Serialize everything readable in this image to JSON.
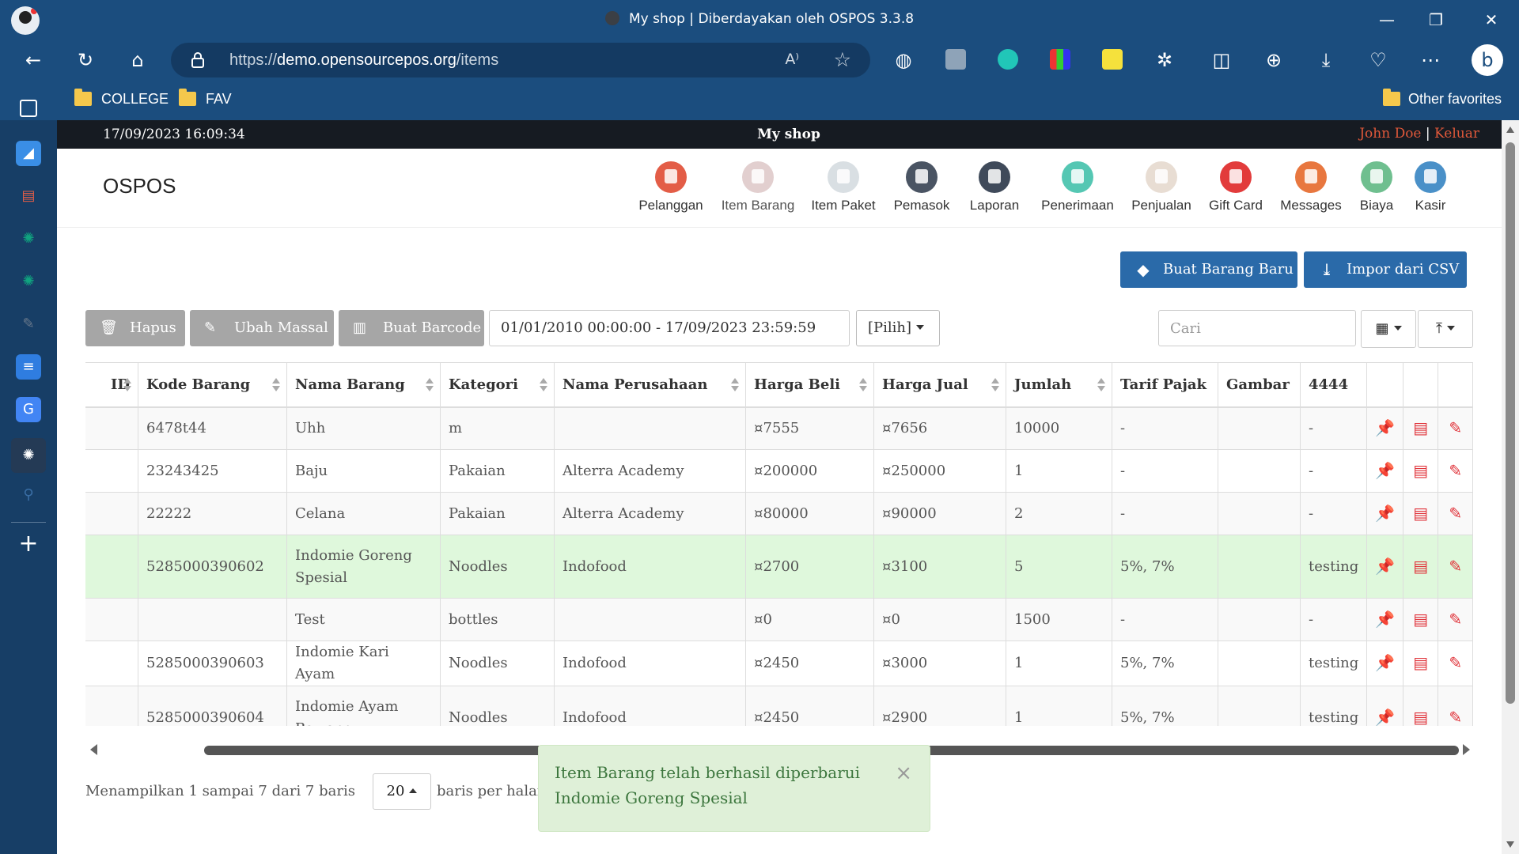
{
  "browser": {
    "window_title": "My shop | Diberdayakan oleh OSPOS 3.3.8",
    "url_prefix": "https://",
    "url_domain": "demo.opensourcepos.org",
    "url_path": "/items",
    "bookmarks": [
      "COLLEGE",
      "FAV"
    ],
    "other_favorites": "Other favorites"
  },
  "topbar": {
    "datetime": "17/09/2023 16:09:34",
    "shop_name": "My shop",
    "user": "John Doe",
    "separator": "|",
    "logout": "Keluar"
  },
  "header": {
    "brand": "OSPOS",
    "modules": [
      {
        "label": "Pelanggan",
        "icon": "customers-icon",
        "color": "#e35d47"
      },
      {
        "label": "Item Barang",
        "icon": "items-icon",
        "color": "#d8cfc5"
      },
      {
        "label": "Item Paket",
        "icon": "item-kits-icon",
        "color": "#d9dfe3"
      },
      {
        "label": "Pemasok",
        "icon": "suppliers-icon",
        "color": "#4a5463"
      },
      {
        "label": "Laporan",
        "icon": "reports-icon",
        "color": "#3f4a5a"
      },
      {
        "label": "Penerimaan",
        "icon": "receivings-icon",
        "color": "#55c7b3"
      },
      {
        "label": "Penjualan",
        "icon": "sales-icon",
        "color": "#e8ddd3"
      },
      {
        "label": "Gift Card",
        "icon": "giftcard-icon",
        "color": "#e23b3b"
      },
      {
        "label": "Messages",
        "icon": "messages-icon",
        "color": "#e8773f"
      },
      {
        "label": "Biaya",
        "icon": "expenses-icon",
        "color": "#6fbf8f"
      },
      {
        "label": "Kasir",
        "icon": "cashups-icon",
        "color": "#4a90c8"
      }
    ]
  },
  "actions": {
    "new_item": "Buat Barang Baru",
    "import_csv": "Impor dari CSV",
    "delete": "Hapus",
    "bulk_edit": "Ubah Massal",
    "barcode": "Buat Barcode",
    "daterange": "01/01/2010 00:00:00 - 17/09/2023 23:59:59",
    "filter": "[Pilih]",
    "search_placeholder": "Cari"
  },
  "table": {
    "columns": [
      "ID",
      "Kode Barang",
      "Nama Barang",
      "Kategori",
      "Nama Perusahaan",
      "Harga Beli",
      "Harga Jual",
      "Jumlah",
      "Tarif Pajak",
      "Gambar",
      "4444"
    ],
    "rows": [
      {
        "id": "",
        "code": "6478t44",
        "name": "Uhh",
        "category": "m",
        "company": "",
        "cost": "¤7555",
        "price": "¤7656",
        "qty": "10000",
        "tax": "-",
        "image": "",
        "c4444": "-"
      },
      {
        "id": "",
        "code": "23243425",
        "name": "Baju",
        "category": "Pakaian",
        "company": "Alterra Academy",
        "cost": "¤200000",
        "price": "¤250000",
        "qty": "1",
        "tax": "-",
        "image": "",
        "c4444": "-"
      },
      {
        "id": "",
        "code": "22222",
        "name": "Celana",
        "category": "Pakaian",
        "company": "Alterra Academy",
        "cost": "¤80000",
        "price": "¤90000",
        "qty": "2",
        "tax": "-",
        "image": "",
        "c4444": "-"
      },
      {
        "id": "",
        "code": "5285000390602",
        "name": "Indomie Goreng Spesial",
        "category": "Noodles",
        "company": "Indofood",
        "cost": "¤2700",
        "price": "¤3100",
        "qty": "5",
        "tax": "5%, 7%",
        "image": "",
        "c4444": "testing"
      },
      {
        "id": "",
        "code": "",
        "name": "Test",
        "category": "bottles",
        "company": "",
        "cost": "¤0",
        "price": "¤0",
        "qty": "1500",
        "tax": "-",
        "image": "",
        "c4444": "-"
      },
      {
        "id": "",
        "code": "5285000390603",
        "name": "Indomie Kari Ayam",
        "category": "Noodles",
        "company": "Indofood",
        "cost": "¤2450",
        "price": "¤3000",
        "qty": "1",
        "tax": "5%, 7%",
        "image": "",
        "c4444": "testing"
      },
      {
        "id": "",
        "code": "5285000390604",
        "name": "Indomie Ayam Bawang",
        "category": "Noodles",
        "company": "Indofood",
        "cost": "¤2450",
        "price": "¤2900",
        "qty": "1",
        "tax": "5%, 7%",
        "image": "",
        "c4444": "testing"
      }
    ]
  },
  "pagination": {
    "summary": "Menampilkan 1 sampai 7 dari 7 baris",
    "page_size": "20",
    "per_page_label": "baris per halaman"
  },
  "toast": {
    "message": "Item Barang telah berhasil diperbarui Indomie Goreng Spesial",
    "close": "×"
  }
}
